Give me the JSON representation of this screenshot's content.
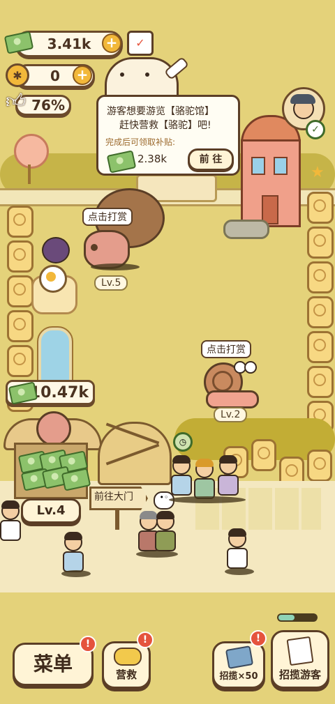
{
  "hud": {
    "money": "3.41k",
    "paw": "0",
    "rating": "76%"
  },
  "quest": {
    "line1": "游客想要游览【骆驼馆】",
    "line2": "赶快营救【骆驼】吧!",
    "reward_label": "完成后可领取补贴:",
    "reward_value": "2.38k",
    "go_button": "前 往"
  },
  "animals": [
    {
      "tip": "点击打赏",
      "level": "Lv.5"
    },
    {
      "tip": "点击打赏",
      "level": "Lv.2"
    }
  ],
  "shop": {
    "money": "10.47k",
    "level": "Lv.4"
  },
  "gate_sign": "前往大门",
  "bottom": {
    "menu": "菜单",
    "rescue": "营救",
    "recruit50": "招揽×50",
    "recruit": "招揽游客"
  },
  "icons": [
    "money-icon",
    "calendar-check-icon",
    "paw-icon",
    "thumbs-up-icon",
    "lollipop-icon",
    "star-icon",
    "clock-icon",
    "helicopter-icon",
    "tickets-icon",
    "papers-icon"
  ],
  "colors": {
    "ground": "#e4d27a",
    "accent": "#f2b83a",
    "outline": "#5b3e26",
    "badge": "#e5533d"
  }
}
